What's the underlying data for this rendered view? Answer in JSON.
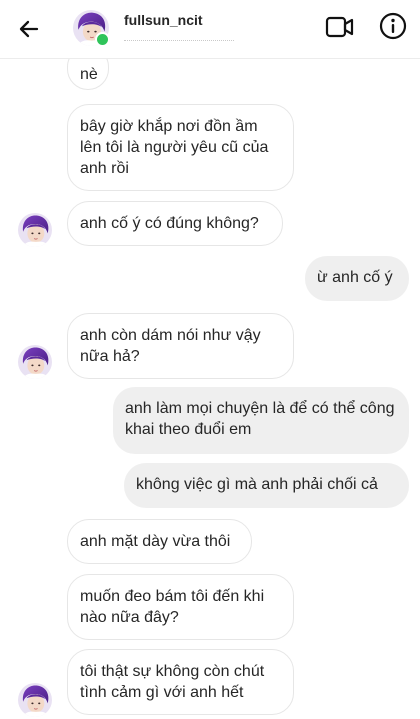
{
  "header": {
    "username": "fullsun_ncit",
    "back_icon": "arrow-left-icon",
    "video_icon": "video-call-icon",
    "info_icon": "info-icon",
    "online_color": "#2fc45a"
  },
  "messages": [
    {
      "side": "received",
      "text": "nè"
    },
    {
      "side": "received",
      "text": "bây giờ khắp nơi đồn ầm lên tôi là người yêu cũ của anh rồi"
    },
    {
      "side": "received",
      "text": "anh cố ý có đúng không?"
    },
    {
      "side": "sent",
      "text": "ừ anh cố ý"
    },
    {
      "side": "received",
      "text": "anh còn dám nói như vậy nữa hả?"
    },
    {
      "side": "sent",
      "text": "anh làm mọi chuyện là để có thể công khai theo đuổi em"
    },
    {
      "side": "sent",
      "text": "không việc gì mà anh phải chối cả"
    },
    {
      "side": "received",
      "text": "anh mặt dày vừa thôi"
    },
    {
      "side": "received",
      "text": "muốn đeo bám tôi đến khi nào nữa đây?"
    },
    {
      "side": "received",
      "text": "tôi thật sự không còn chút tình cảm gì với anh hết"
    }
  ],
  "colors": {
    "sent_bubble": "#efefef",
    "received_border": "#e6e6e6",
    "text": "#262626"
  }
}
